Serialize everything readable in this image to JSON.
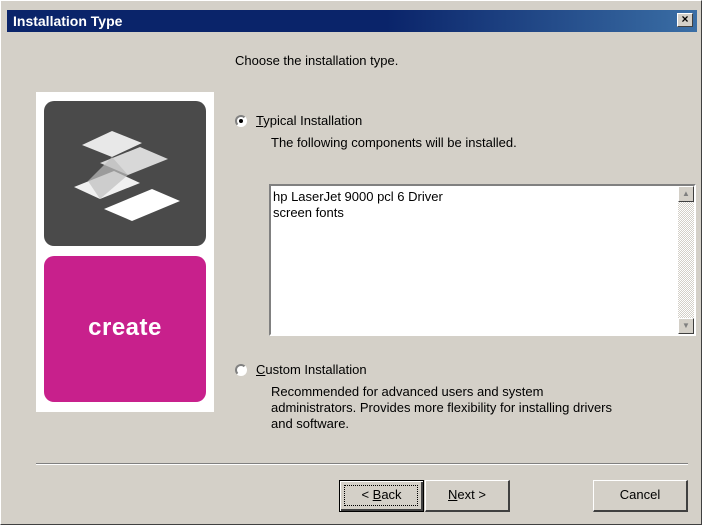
{
  "window": {
    "title": "Installation Type",
    "close_glyph": "×"
  },
  "logo": {
    "text": "create",
    "top_color": "#4a4a4a",
    "bottom_color": "#c8208c"
  },
  "heading": "Choose the installation type.",
  "options": {
    "typical": {
      "label_first": "T",
      "label_rest": "ypical Installation",
      "description": "The following components will be installed.",
      "selected": true
    },
    "custom": {
      "label_first": "C",
      "label_rest": "ustom Installation",
      "description_lines": [
        "Recommended for advanced users and system",
        "administrators.  Provides more flexibility for installing drivers",
        "and software."
      ],
      "selected": false
    }
  },
  "components": [
    "hp LaserJet 9000 pcl 6 Driver",
    "screen fonts"
  ],
  "buttons": {
    "back_mnemonic": "B",
    "back_rest": "ack",
    "back_prefix": "< ",
    "next_mnemonic": "N",
    "next_rest": "ext >",
    "cancel": "Cancel"
  }
}
